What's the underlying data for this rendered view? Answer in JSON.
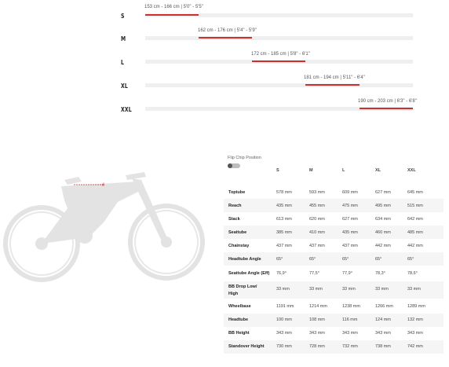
{
  "size_chart": {
    "sizes": [
      {
        "label": "S",
        "range": "153 cm - 166 cm | 5'0\" - 5'5\""
      },
      {
        "label": "M",
        "range": "162 cm - 176 cm | 5'4\" - 5'9\""
      },
      {
        "label": "L",
        "range": "172 cm - 185 cm | 5'8\" - 6'1\""
      },
      {
        "label": "XL",
        "range": "181 cm - 194 cm | 5'11\" - 6'4\""
      },
      {
        "label": "XXL",
        "range": "190 cm - 203 cm | 6'3\" - 6'8\""
      }
    ],
    "accent_color": "#cf2e2e"
  },
  "bike_image": {
    "icon": "bike-silhouette-icon",
    "marker": "#"
  },
  "flip_chip": {
    "title": "Flip Chip Position"
  },
  "geometry": {
    "columns": [
      "S",
      "M",
      "L",
      "XL",
      "XXL"
    ],
    "rows": [
      {
        "name": "Toptube",
        "values": [
          "578 mm",
          "593 mm",
          "609 mm",
          "627 mm",
          "645 mm"
        ]
      },
      {
        "name": "Reach",
        "values": [
          "435 mm",
          "455 mm",
          "475 mm",
          "495 mm",
          "515 mm"
        ]
      },
      {
        "name": "Stack",
        "values": [
          "613 mm",
          "620 mm",
          "627 mm",
          "634 mm",
          "642 mm"
        ]
      },
      {
        "name": "Seattube",
        "values": [
          "385 mm",
          "410 mm",
          "435 mm",
          "460 mm",
          "485 mm"
        ]
      },
      {
        "name": "Chainstay",
        "values": [
          "437 mm",
          "437 mm",
          "437 mm",
          "442 mm",
          "442 mm"
        ]
      },
      {
        "name": "Headtube Angle",
        "values": [
          "65°",
          "65°",
          "65°",
          "65°",
          "65°"
        ]
      },
      {
        "name": "Seattube Angle (Eff)",
        "values": [
          "76,9°",
          "77,5°",
          "77,9°",
          "78,3°",
          "78,6°"
        ]
      },
      {
        "name": "BB Drop Low/ High",
        "values": [
          "33 mm",
          "33 mm",
          "33 mm",
          "33 mm",
          "33 mm"
        ]
      },
      {
        "name": "Wheelbase",
        "values": [
          "1191 mm",
          "1214 mm",
          "1238 mm",
          "1266 mm",
          "1289 mm"
        ]
      },
      {
        "name": "Headtube",
        "values": [
          "100 mm",
          "108 mm",
          "116 mm",
          "124 mm",
          "132 mm"
        ]
      },
      {
        "name": "BB Height",
        "values": [
          "343 mm",
          "343 mm",
          "343 mm",
          "343 mm",
          "343 mm"
        ]
      },
      {
        "name": "Standover Height",
        "values": [
          "730 mm",
          "728 mm",
          "732 mm",
          "738 mm",
          "742 mm"
        ]
      }
    ]
  }
}
